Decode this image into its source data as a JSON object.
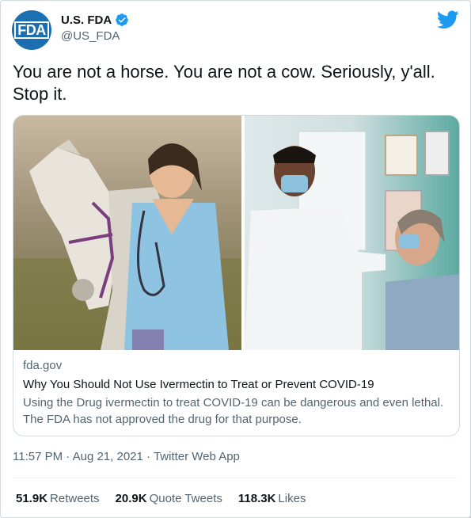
{
  "author": {
    "avatar_text": "FDA",
    "display_name": "U.S. FDA",
    "handle": "@US_FDA",
    "verified": true
  },
  "tweet": {
    "text": "You are not a horse. You are not a cow. Seriously, y'all. Stop it."
  },
  "card": {
    "domain": "fda.gov",
    "title": "Why You Should Not Use Ivermectin to Treat or Prevent COVID-19",
    "description": "Using the Drug ivermectin to treat COVID-19 can be dangerous and even lethal. The FDA has not approved the drug for that purpose."
  },
  "meta": {
    "time": "11:57 PM",
    "date": "Aug 21, 2021",
    "source": "Twitter Web App"
  },
  "stats": {
    "retweets_count": "51.9K",
    "retweets_label": "Retweets",
    "quote_count": "20.9K",
    "quote_label": "Quote Tweets",
    "likes_count": "118.3K",
    "likes_label": "Likes"
  },
  "colors": {
    "brand_blue": "#1d9bf0",
    "fda_blue": "#1c6fb0",
    "text_primary": "#0f1419",
    "text_secondary": "#536471"
  },
  "icons": [
    "twitter-bird-icon",
    "verified-badge-icon"
  ]
}
